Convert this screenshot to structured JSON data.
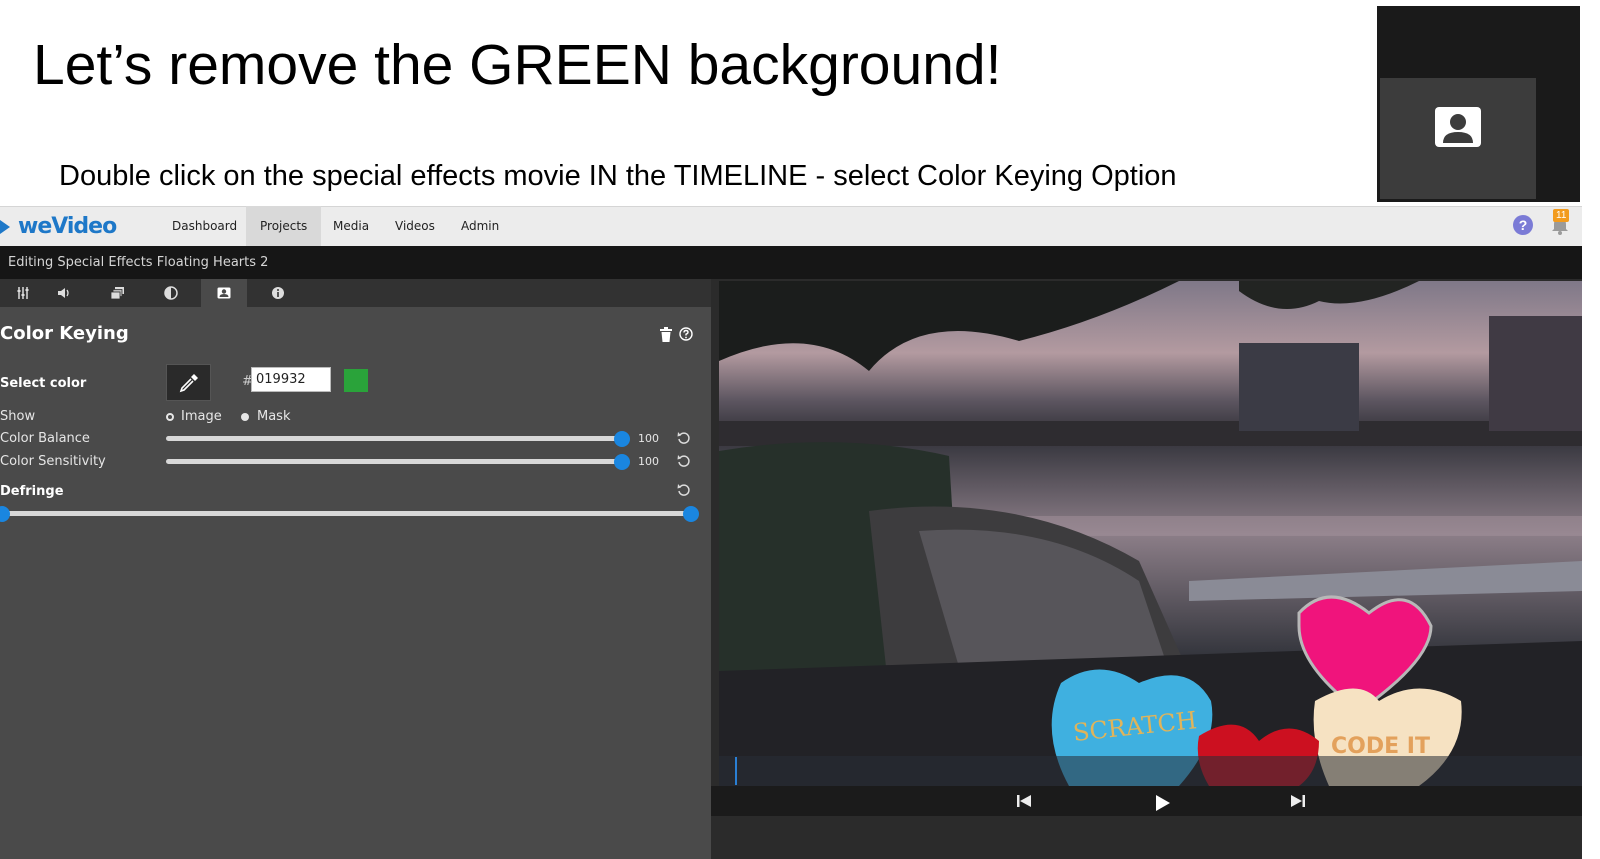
{
  "slide": {
    "title": "Let’s remove the GREEN background!",
    "subtitle": "Double click on the special effects movie IN the TIMELINE - select Color Keying Option"
  },
  "camera_tile": {
    "icon": "user-avatar-icon"
  },
  "app": {
    "logo": "weVideo",
    "nav": [
      "Dashboard",
      "Projects",
      "Media",
      "Videos",
      "Admin"
    ],
    "active_nav": "Projects",
    "notifications": "11",
    "help_label": "?"
  },
  "editor": {
    "title": "Editing Special Effects Floating Hearts 2",
    "tabs": [
      "mixer-icon",
      "volume-icon",
      "layers-icon",
      "contrast-icon",
      "color-keying-icon",
      "info-icon"
    ],
    "active_tab": "color-keying-icon"
  },
  "color_keying": {
    "section_title": "Color Keying",
    "select_color_label": "Select color",
    "hash": "#",
    "hex_value": "019932",
    "swatch_color": "#2aa33a",
    "show_label": "Show",
    "show_options": [
      "Image",
      "Mask"
    ],
    "show_selected": "Mask",
    "color_balance_label": "Color Balance",
    "color_balance_value": "100",
    "color_sensitivity_label": "Color Sensitivity",
    "color_sensitivity_value": "100",
    "defringe_label": "Defringe",
    "defringe_level": 1.0
  },
  "video": {
    "heart_texts": [
      "SCRATCH",
      "CODE IT"
    ],
    "playhead": 0.02
  }
}
